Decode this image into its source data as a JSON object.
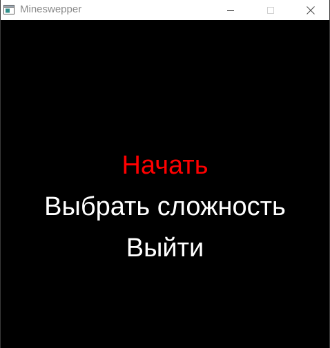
{
  "window": {
    "title": "Mineswepper"
  },
  "menu": {
    "items": [
      {
        "label": "Начать",
        "color": "#ff0000",
        "selected": true
      },
      {
        "label": "Выбрать сложность",
        "color": "#ffffff",
        "selected": false
      },
      {
        "label": "Выйти",
        "color": "#ffffff",
        "selected": false
      }
    ]
  },
  "colors": {
    "background": "#000000",
    "titlebar": "#ffffff",
    "title_text": "#8a8a8a",
    "selected_item": "#ff0000",
    "item": "#ffffff"
  },
  "icons": {
    "app": "app-window-icon",
    "minimize": "minimize-icon",
    "maximize": "maximize-icon",
    "close": "close-icon"
  }
}
